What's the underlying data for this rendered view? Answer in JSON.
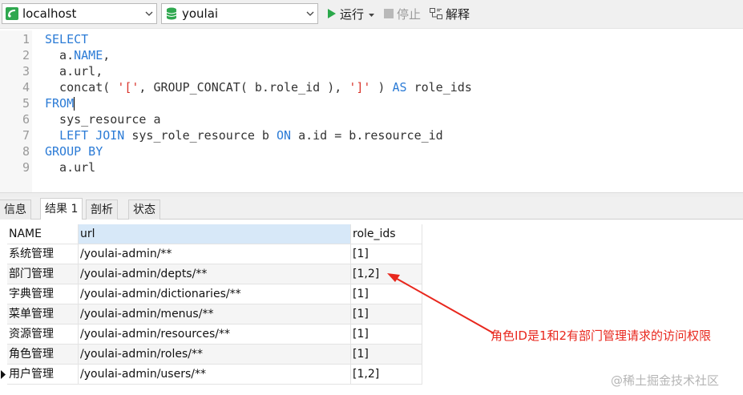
{
  "toolbar": {
    "connection": "localhost",
    "database": "youlai",
    "run_label": "运行",
    "stop_label": "停止",
    "explain_label": "解释",
    "icons": {
      "connection": "connection-icon",
      "database": "database-icon",
      "run": "play-icon",
      "stop": "stop-icon",
      "explain": "explain-icon"
    }
  },
  "editor": {
    "line_numbers": [
      "1",
      "2",
      "3",
      "4",
      "5",
      "6",
      "7",
      "8",
      "9"
    ],
    "lines": [
      [
        {
          "t": "SELECT",
          "k": "kw"
        }
      ],
      [
        {
          "t": "  a."
        },
        {
          "t": "NAME",
          "k": "kw"
        },
        {
          "t": ","
        }
      ],
      [
        {
          "t": "  a.url,"
        }
      ],
      [
        {
          "t": "  concat( "
        },
        {
          "t": "'['",
          "k": "str"
        },
        {
          "t": ", GROUP_CONCAT( b.role_id ), "
        },
        {
          "t": "']'",
          "k": "str"
        },
        {
          "t": " ) "
        },
        {
          "t": "AS",
          "k": "kw"
        },
        {
          "t": " role_ids"
        }
      ],
      [
        {
          "t": "FROM",
          "k": "kw"
        }
      ],
      [
        {
          "t": "  sys_resource a"
        }
      ],
      [
        {
          "t": "  "
        },
        {
          "t": "LEFT JOIN",
          "k": "kw"
        },
        {
          "t": " sys_role_resource b "
        },
        {
          "t": "ON",
          "k": "kw"
        },
        {
          "t": " a.id = b.resource_id"
        }
      ],
      [
        {
          "t": "GROUP BY",
          "k": "kw"
        }
      ],
      [
        {
          "t": "  a.url"
        }
      ]
    ]
  },
  "tabs": [
    {
      "label": "信息",
      "active": false
    },
    {
      "label": "结果 1",
      "active": true
    },
    {
      "label": "剖析",
      "active": false
    },
    {
      "label": "状态",
      "active": false
    }
  ],
  "result": {
    "columns": [
      "NAME",
      "url",
      "role_ids"
    ],
    "rows": [
      [
        "系统管理",
        "/youlai-admin/**",
        "[1]"
      ],
      [
        "部门管理",
        "/youlai-admin/depts/**",
        "[1,2]"
      ],
      [
        "字典管理",
        "/youlai-admin/dictionaries/**",
        "[1]"
      ],
      [
        "菜单管理",
        "/youlai-admin/menus/**",
        "[1]"
      ],
      [
        "资源管理",
        "/youlai-admin/resources/**",
        "[1]"
      ],
      [
        "角色管理",
        "/youlai-admin/roles/**",
        "[1]"
      ],
      [
        "用户管理",
        "/youlai-admin/users/**",
        "[1,2]"
      ]
    ],
    "current_row": 6
  },
  "annotation": {
    "text": "角色ID是1和2有部门管理请求的访问权限",
    "color": "#e8271d"
  },
  "watermark": "@稀土掘金技术社区"
}
